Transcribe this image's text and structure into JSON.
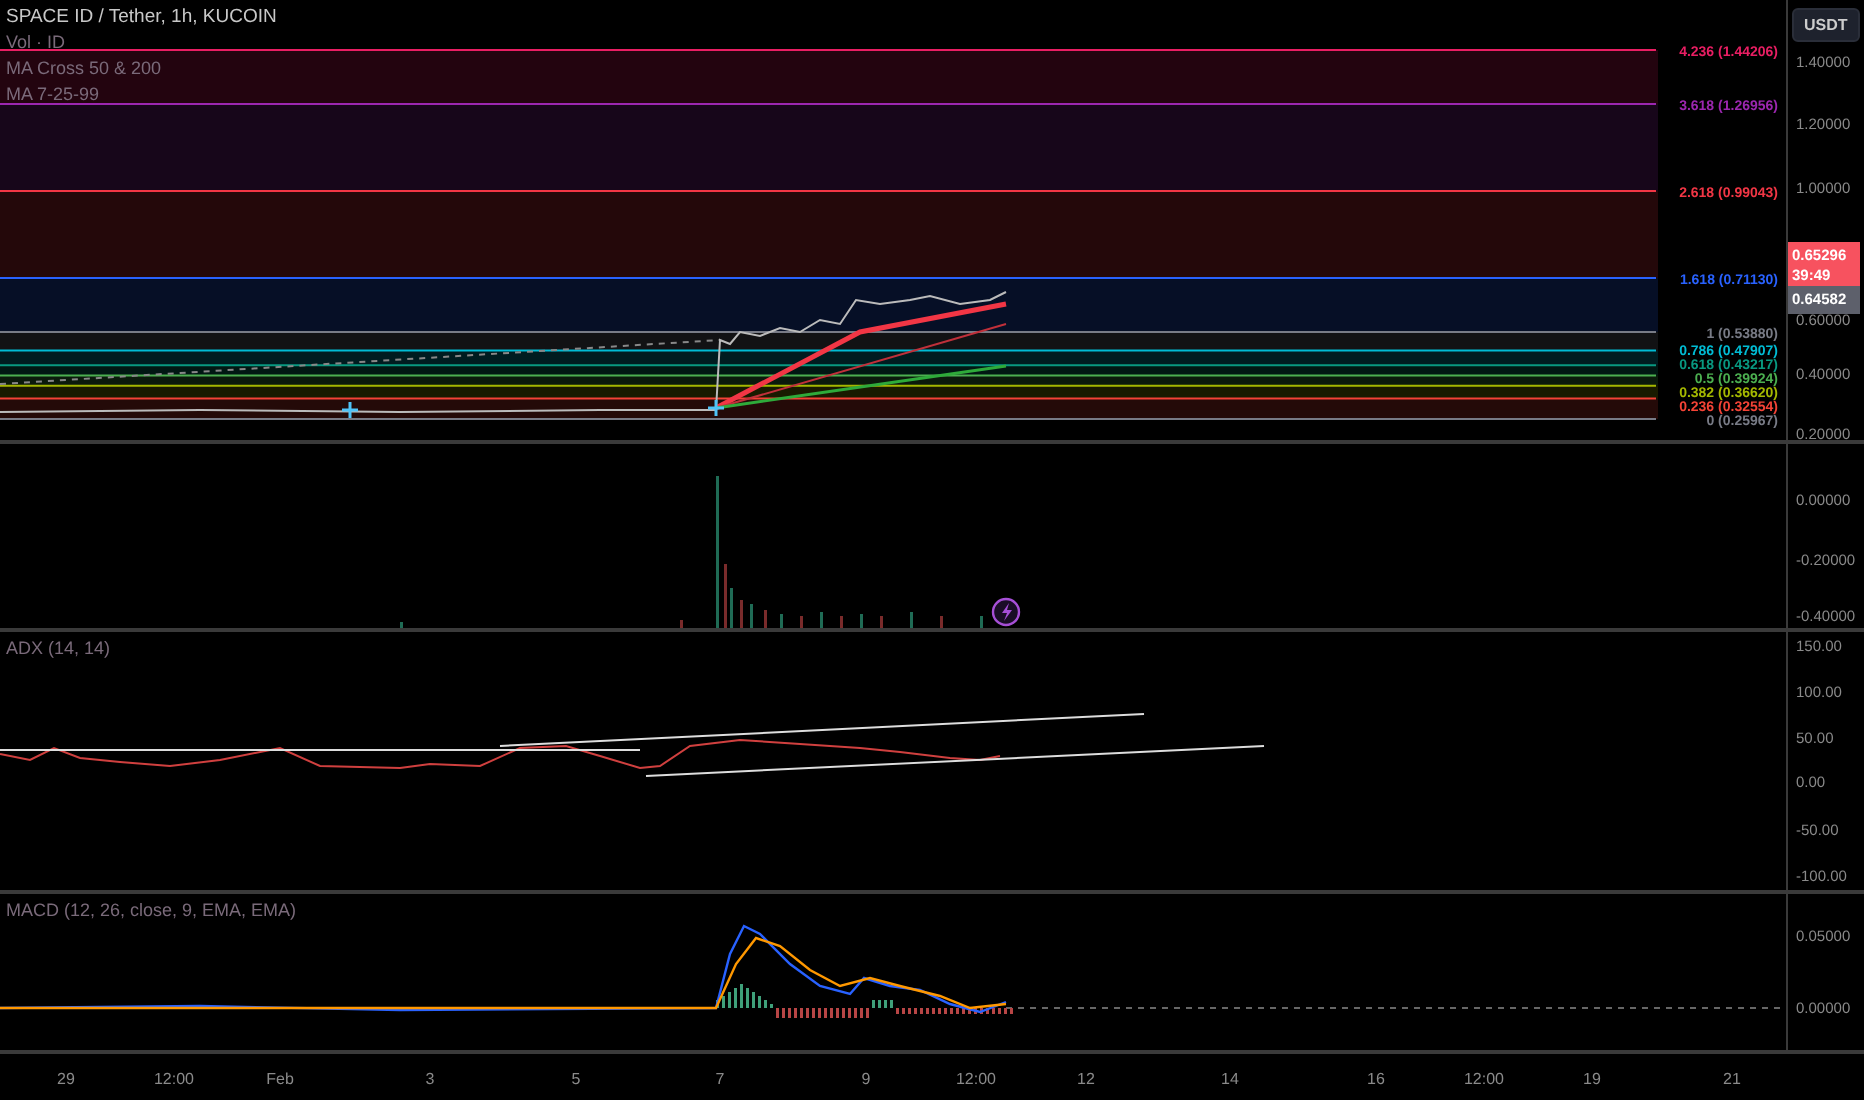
{
  "price_pane": {
    "legend": [
      "SPACE ID / Tether, 1h, KUCOIN",
      "Vol · ID",
      "MA Cross 50 & 200",
      "MA 7-25-99"
    ],
    "fib_levels": [
      {
        "label": "4.236 (1.44206)",
        "color": "#e91e63"
      },
      {
        "label": "3.618 (1.26956)",
        "color": "#9c27b0"
      },
      {
        "label": "2.618 (0.99043)",
        "color": "#f23645"
      },
      {
        "label": "1.618 (0.71130)",
        "color": "#2962ff"
      },
      {
        "label": "1 (0.53880)",
        "color": "#787b86"
      },
      {
        "label": "0.786 (0.47907)",
        "color": "#00bcd4"
      },
      {
        "label": "0.618 (0.43217)",
        "color": "#089981"
      },
      {
        "label": "0.5 (0.39924)",
        "color": "#4caf50"
      },
      {
        "label": "0.382 (0.36620)",
        "color": "#a5b800"
      },
      {
        "label": "0.236 (0.32554)",
        "color": "#f44336"
      },
      {
        "label": "0 (0.25967)",
        "color": "#787b86"
      }
    ],
    "currency_button": "USDT",
    "axis_ticks": [
      "1.40000",
      "1.20000",
      "1.00000",
      "0.60000",
      "0.40000",
      "0.20000"
    ],
    "price_tags": [
      {
        "kind": "last",
        "value": "0.65296",
        "countdown": "39:49"
      },
      {
        "kind": "previous",
        "value": "0.64582"
      }
    ]
  },
  "volume_pane": {
    "axis_ticks": [
      "0.00000",
      "-0.20000",
      "-0.40000"
    ]
  },
  "adx_pane": {
    "legend": "ADX (14, 14)",
    "axis_ticks": [
      "150.00",
      "100.00",
      "50.00",
      "0.00",
      "-50.00",
      "-100.00"
    ]
  },
  "macd_pane": {
    "legend": "MACD (12, 26, close, 9, EMA, EMA)",
    "axis_ticks": [
      "0.05000",
      "0.00000"
    ]
  },
  "time_axis": [
    "29",
    "12:00",
    "Feb",
    "3",
    "5",
    "7",
    "9",
    "12:00",
    "12",
    "14",
    "16",
    "12:00",
    "19",
    "21"
  ]
}
